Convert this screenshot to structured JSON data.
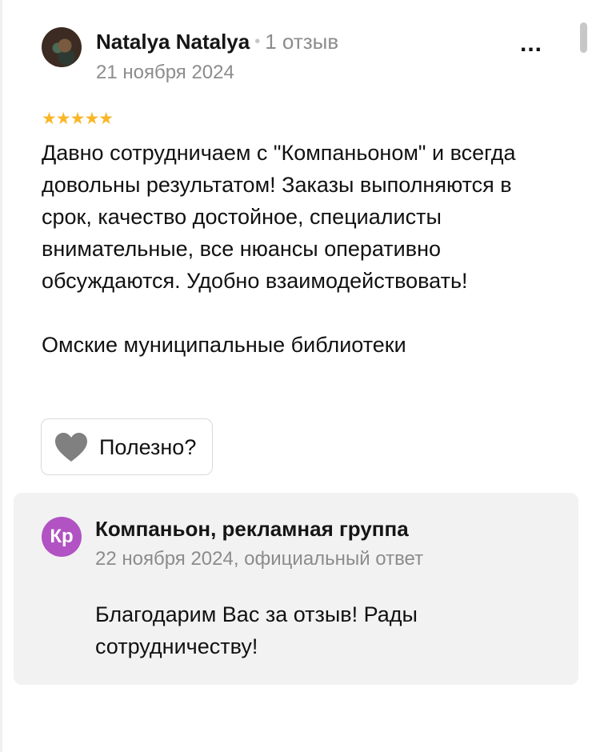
{
  "review": {
    "author_name": "Natalya Natalya",
    "separator": "•",
    "review_count": "1 отзыв",
    "date": "21 ноября 2024",
    "more_label": "...",
    "rating": 5,
    "rating_stars": "★★★★★",
    "text_paragraph_1": "Давно сотрудничаем с \"Компаньоном\" и всегда довольны результатом! Заказы выполняются в срок, качество достойное, специалисты внимательные, все нюансы оперативно обсуждаются. Удобно взаимодействовать!",
    "text_paragraph_2": "Омские муниципальные библиотеки",
    "useful_label": "Полезно?"
  },
  "business_answer": {
    "avatar_initials": "Кр",
    "avatar_color": "#b153c2",
    "name": "Компаньон, рекламная группа",
    "meta": "22 ноября 2024, официальный ответ",
    "text": "Благодарим Вас за отзыв! Рады сотрудничеству!"
  },
  "colors": {
    "star": "#fab627",
    "muted_text": "#8c8c8c",
    "answer_background": "#f2f2f2",
    "heart": "#808080"
  },
  "icons": {
    "more": "more-dots-icon",
    "like": "heart-icon"
  }
}
